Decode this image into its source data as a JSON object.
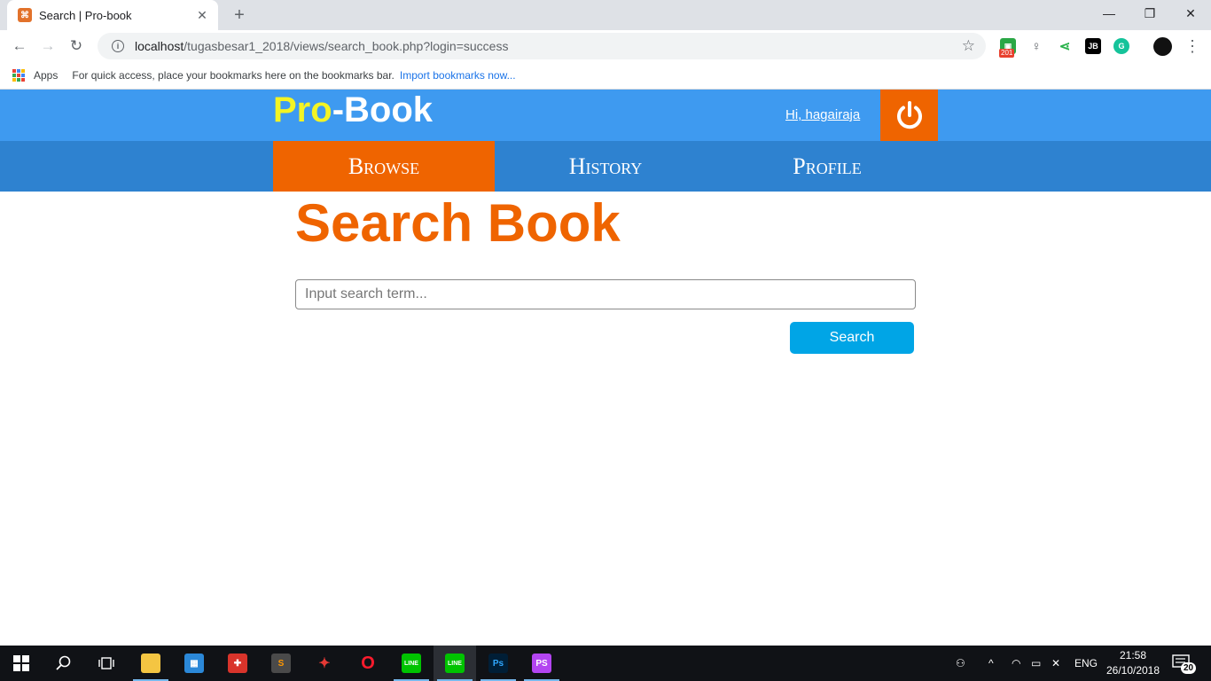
{
  "browser": {
    "tab_title": "Search | Pro-book",
    "url_host": "localhost",
    "url_path": "/tugasbesar1_2018/views/search_book.php?login=success",
    "extension_badge": "201",
    "bookmarks": {
      "apps_label": "Apps",
      "hint": "For quick access, place your bookmarks here on the bookmarks bar.",
      "import_link": "Import bookmarks now..."
    }
  },
  "site": {
    "logo_pro": "Pro",
    "logo_book": "-Book",
    "greeting": "Hi, hagairaja",
    "nav": [
      {
        "label": "Browse",
        "active": true
      },
      {
        "label": "History",
        "active": false
      },
      {
        "label": "Profile",
        "active": false
      }
    ]
  },
  "main": {
    "title": "Search Book",
    "search_placeholder": "Input search term...",
    "search_button": "Search"
  },
  "taskbar": {
    "language": "ENG",
    "time": "21:58",
    "date": "26/10/2018",
    "notification_count": "20"
  },
  "colors": {
    "header_blue": "#3e9af0",
    "nav_blue": "#2e82d0",
    "accent_orange": "#ef6400",
    "logo_yellow": "#f3f424",
    "button_blue": "#00a5e6"
  }
}
